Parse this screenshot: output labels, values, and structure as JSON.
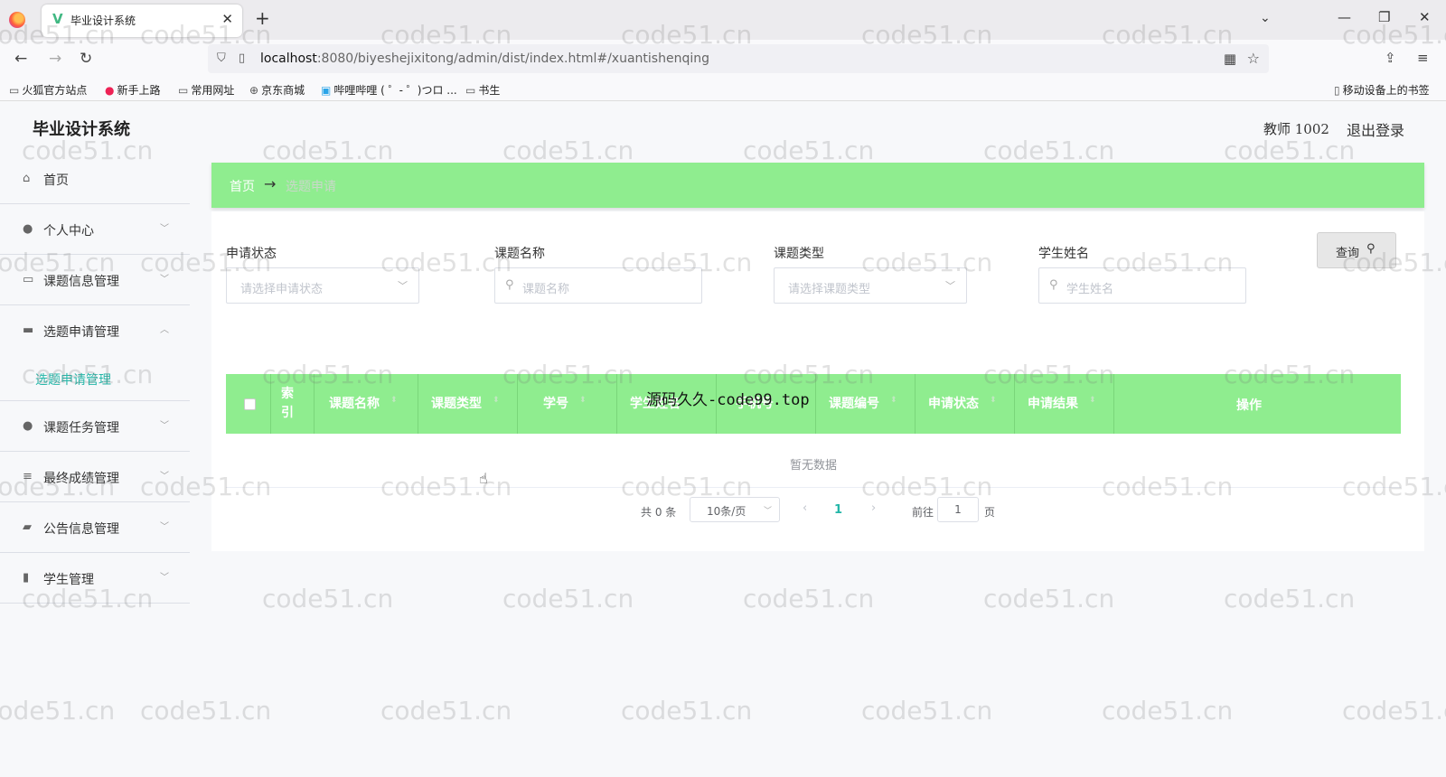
{
  "browser": {
    "tab_title": "毕业设计系统",
    "tab_icon": "vue-logo-icon",
    "url_host": "localhost",
    "url_rest": ":8080/biyeshejixitong/admin/dist/index.html#/xuantishenqing",
    "bookmarks": [
      "火狐官方站点",
      "新手上路",
      "常用网址",
      "京东商城",
      "哔哩哔哩 ( ゜- ゜)つロ ...",
      "书生"
    ],
    "mobile_bookmarks": "移动设备上的书签"
  },
  "header": {
    "title": "毕业设计系统",
    "user": "教师 1002",
    "logout": "退出登录"
  },
  "sidebar": {
    "items": [
      {
        "label": "首页",
        "icon": "home-icon"
      },
      {
        "label": "个人中心",
        "icon": "user-icon"
      },
      {
        "label": "课题信息管理",
        "icon": "message-icon"
      },
      {
        "label": "选题申请管理",
        "icon": "monitor-icon"
      },
      {
        "label": "课题任务管理",
        "icon": "user-icon"
      },
      {
        "label": "最终成绩管理",
        "icon": "list-icon"
      },
      {
        "label": "公告信息管理",
        "icon": "ticket-icon"
      },
      {
        "label": "学生管理",
        "icon": "chart-icon"
      }
    ],
    "sub_active": "选题申请管理"
  },
  "breadcrumb": {
    "home": "首页",
    "separator": "→",
    "current": "选题申请"
  },
  "filters": {
    "status_label": "申请状态",
    "status_placeholder": "请选择申请状态",
    "topic_name_label": "课题名称",
    "topic_name_placeholder": "课题名称",
    "topic_type_label": "课题类型",
    "topic_type_placeholder": "请选择课题类型",
    "student_name_label": "学生姓名",
    "student_name_placeholder": "学生姓名",
    "query_button": "查询"
  },
  "table": {
    "columns": [
      "索引",
      "课题名称",
      "课题类型",
      "学号",
      "学生姓名",
      "手机号",
      "课题编号",
      "申请状态",
      "申请结果",
      "操作"
    ],
    "empty_text": "暂无数据"
  },
  "pagination": {
    "total": "共 0 条",
    "page_size": "10条/页",
    "current_page": "1",
    "goto_label": "前往",
    "goto_value": "1",
    "page_suffix": "页"
  },
  "watermark": "code51.cn",
  "overlay_text": "源码久久-code99.top",
  "colors": {
    "accent_green": "#8fed8f",
    "active_teal": "#24b6a8"
  }
}
